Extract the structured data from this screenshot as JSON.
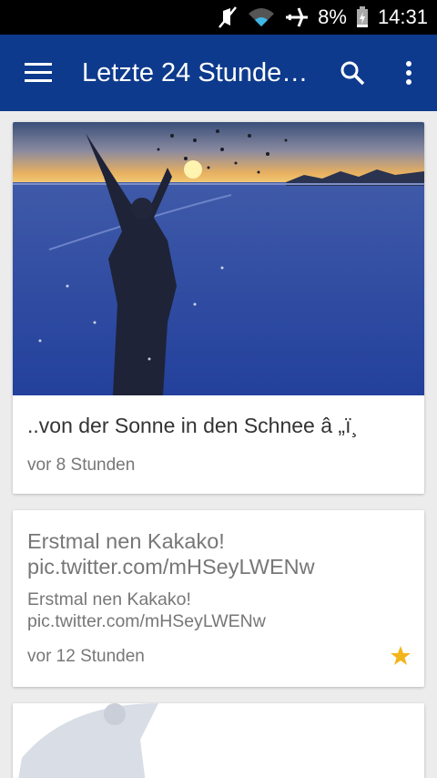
{
  "status_bar": {
    "battery": "8%",
    "time": "14:31",
    "icons": [
      "muted-icon",
      "wifi-icon",
      "airplane-icon",
      "battery-icon"
    ]
  },
  "app_bar": {
    "title": "Letzte 24 Stunde…",
    "icons": [
      "menu-icon",
      "search-icon",
      "more-vert-icon"
    ]
  },
  "colors": {
    "app_bar": "#0d3a8c",
    "star": "#f2b51b",
    "background": "#ececec"
  },
  "feed": {
    "items": [
      {
        "title": "..von der Sonne in den Schnee â „ï¸",
        "time": "vor 8 Stunden",
        "image": "person throwing snow at sunset"
      },
      {
        "title": "Erstmal nen Kakako! pic.twitter.com/mHSeyLWENw",
        "body": "Erstmal nen Kakako! pic.twitter.com/mHSeyLWENw",
        "time": "vor 12 Stunden",
        "starred": true
      }
    ]
  }
}
